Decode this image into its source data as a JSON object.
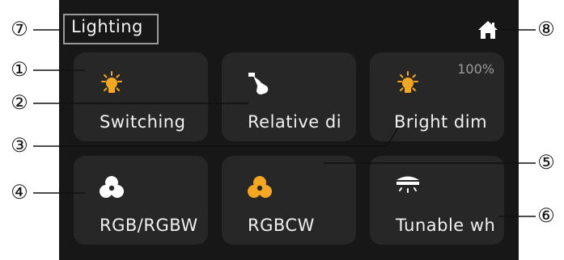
{
  "header": {
    "title": "Lighting",
    "home_icon": "home-icon"
  },
  "tiles": [
    {
      "label": "Switching",
      "icon": "bulb-icon",
      "icon_color": "#f5a623"
    },
    {
      "label": "Relative di",
      "icon": "spotlight-icon",
      "icon_color": "#ffffff"
    },
    {
      "label": "Bright dim",
      "icon": "bulb-icon",
      "icon_color": "#f5a623",
      "value": "100%"
    },
    {
      "label": "RGB/RGBW",
      "icon": "rgb-icon",
      "icon_color": "#ffffff"
    },
    {
      "label": "RGBCW",
      "icon": "rgb-icon",
      "icon_color": "#f5a623"
    },
    {
      "label": "Tunable wh",
      "icon": "ceiling-light-icon",
      "icon_color": "#ffffff"
    }
  ],
  "callouts": [
    "①",
    "②",
    "③",
    "④",
    "⑤",
    "⑥",
    "⑦",
    "⑧"
  ],
  "colors": {
    "screen_bg": "#171717",
    "tile_bg": "#272727",
    "accent": "#f5a623"
  }
}
